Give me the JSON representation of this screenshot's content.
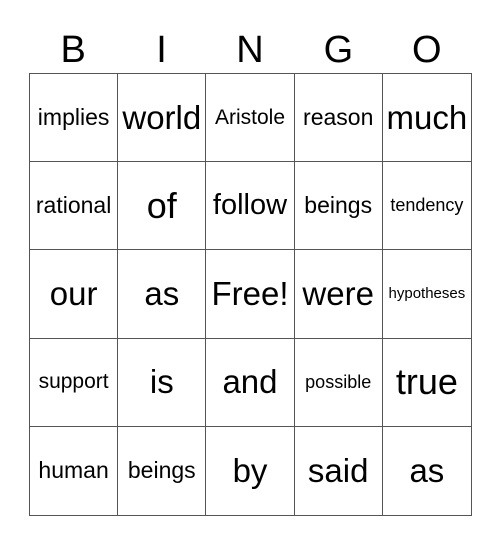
{
  "header": [
    "B",
    "I",
    "N",
    "G",
    "O"
  ],
  "cells": [
    "implies",
    "world",
    "Aristole",
    "reason",
    "much",
    "rational",
    "of",
    "follow",
    "beings",
    "tendency",
    "our",
    "as",
    "Free!",
    "were",
    "hypotheses",
    "support",
    "is",
    "and",
    "possible",
    "true",
    "human",
    "beings",
    "by",
    "said",
    "as"
  ]
}
